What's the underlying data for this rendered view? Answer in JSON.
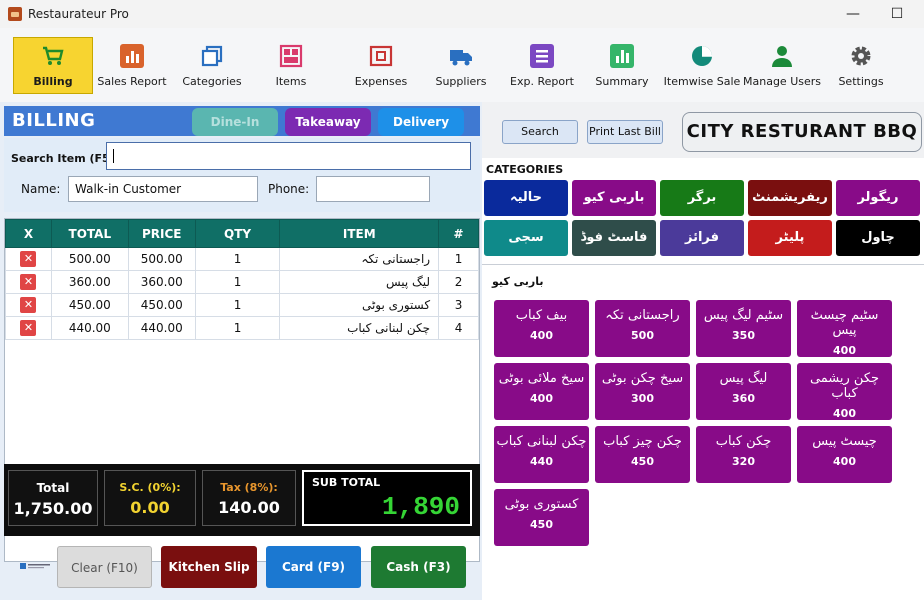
{
  "window": {
    "title": "Restaurateur Pro",
    "minimize": "—",
    "maximize": "☐"
  },
  "toolbar": [
    {
      "id": "billing",
      "label": "Billing",
      "icon": "cart-icon",
      "active": true
    },
    {
      "id": "sales-report",
      "label": "Sales Report",
      "icon": "chart-icon"
    },
    {
      "id": "categories",
      "label": "Categories",
      "icon": "copy-icon"
    },
    {
      "id": "items",
      "label": "Items",
      "icon": "grid-icon"
    },
    {
      "id": "expenses",
      "label": "Expenses",
      "icon": "wallet-icon"
    },
    {
      "id": "suppliers",
      "label": "Suppliers",
      "icon": "truck-icon"
    },
    {
      "id": "exp-report",
      "label": "Exp. Report",
      "icon": "report-icon"
    },
    {
      "id": "summary",
      "label": "Summary",
      "icon": "bars-icon"
    },
    {
      "id": "itemwise-sale",
      "label": "Itemwise Sale",
      "icon": "pie-icon"
    },
    {
      "id": "manage-users",
      "label": "Manage Users",
      "icon": "user-icon"
    },
    {
      "id": "settings",
      "label": "Settings",
      "icon": "gear-icon"
    }
  ],
  "billing": {
    "title": "BILLING",
    "modes": {
      "dine_in": "Dine-In",
      "takeaway": "Takeaway",
      "delivery": "Delivery"
    },
    "search_label": "Search Item (F5):",
    "search_value": "",
    "name_label": "Name:",
    "name_value": "Walk-in Customer",
    "phone_label": "Phone:",
    "phone_value": ""
  },
  "table": {
    "headers": {
      "x": "X",
      "total": "TOTAL",
      "price": "PRICE",
      "qty": "QTY",
      "item": "ITEM",
      "no": "#"
    },
    "rows": [
      {
        "total": "500.00",
        "price": "500.00",
        "qty": "1",
        "item": "راجستانی تکہ",
        "no": "1"
      },
      {
        "total": "360.00",
        "price": "360.00",
        "qty": "1",
        "item": "لیگ پیس",
        "no": "2"
      },
      {
        "total": "450.00",
        "price": "450.00",
        "qty": "1",
        "item": "کستوری بوٹی",
        "no": "3"
      },
      {
        "total": "440.00",
        "price": "440.00",
        "qty": "1",
        "item": "چکن لبنانی کباب",
        "no": "4"
      }
    ]
  },
  "totals": {
    "total_label": "Total",
    "total_value": "1,750.00",
    "sc_label": "S.C. (0%):",
    "sc_value": "0.00",
    "tax_label": "Tax (8%):",
    "tax_value": "140.00",
    "subtotal_label": "SUB TOTAL",
    "subtotal_value": "1,890"
  },
  "actions": {
    "clear": "Clear (F10)",
    "kitchen": "Kitchen Slip",
    "card": "Card (F9)",
    "cash": "Cash (F3)"
  },
  "right": {
    "search_btn": "Search",
    "print_btn": "Print Last Bill",
    "restaurant_name": "CITY RESTURANT BBQ",
    "categories_label": "CATEGORIES",
    "current_category": "باربی کیو"
  },
  "categories": [
    {
      "label": "حالیہ",
      "color": "#0a2a9c"
    },
    {
      "label": "باربی کیو",
      "color": "#880b88"
    },
    {
      "label": "برگر",
      "color": "#177a17"
    },
    {
      "label": "ریفریشمنٹ",
      "color": "#7a0f0f"
    },
    {
      "label": "ریگولر",
      "color": "#880b88"
    },
    {
      "label": "سجی",
      "color": "#0f8a8a"
    },
    {
      "label": "فاسٹ فوڈ",
      "color": "#2f4d4a"
    },
    {
      "label": "فرائز",
      "color": "#4b3a9a"
    },
    {
      "label": "پلیٹر",
      "color": "#c41c1c"
    },
    {
      "label": "چاول",
      "color": "#000000"
    }
  ],
  "products": [
    {
      "name": "بیف کباب",
      "price": "400"
    },
    {
      "name": "راجستانی تکہ",
      "price": "500"
    },
    {
      "name": "سٹیم لیگ پیس",
      "price": "350"
    },
    {
      "name": "سٹیم چیسٹ پیس",
      "price": "400"
    },
    {
      "name": "سیخ ملائی بوٹی",
      "price": "400"
    },
    {
      "name": "سیخ چکن بوٹی",
      "price": "300"
    },
    {
      "name": "لیگ پیس",
      "price": "360"
    },
    {
      "name": "چکن ریشمی کباب",
      "price": "400"
    },
    {
      "name": "چکن لبنانی کباب",
      "price": "440"
    },
    {
      "name": "چکن چیز کباب",
      "price": "450"
    },
    {
      "name": "چکن کباب",
      "price": "320"
    },
    {
      "name": "چیسٹ پیس",
      "price": "400"
    },
    {
      "name": "کستوری بوٹی",
      "price": "450"
    }
  ]
}
